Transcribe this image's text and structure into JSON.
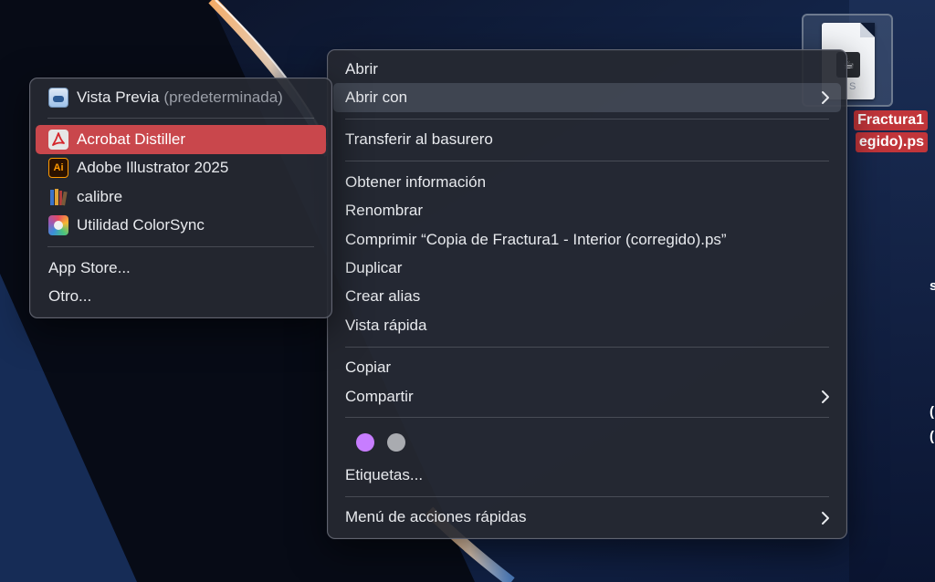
{
  "desktop": {
    "file": {
      "label_line1": "Fractura1",
      "label_line2": "egido).ps",
      "icon_glyph": "☕",
      "icon_ext": "S",
      "label_color": "#c1353a"
    },
    "edge_chars": [
      "s",
      "(",
      "("
    ]
  },
  "context_menu": {
    "open": "Abrir",
    "open_with": "Abrir con",
    "move_to_trash": "Transferir al basurero",
    "get_info": "Obtener información",
    "rename": "Renombrar",
    "compress": "Comprimir “Copia de Fractura1 - Interior (corregido).ps”",
    "duplicate": "Duplicar",
    "make_alias": "Crear alias",
    "quick_look": "Vista rápida",
    "copy": "Copiar",
    "share": "Compartir",
    "tags": [
      {
        "color": "#c77dff"
      },
      {
        "color": "#a9abb0"
      }
    ],
    "tags_label": "Etiquetas...",
    "quick_actions": "Menú de acciones rápidas"
  },
  "open_with_submenu": {
    "default_app": "Vista Previa",
    "default_note": "(predeterminada)",
    "apps": [
      {
        "name": "Acrobat Distiller",
        "icon": "acrobat-icon"
      },
      {
        "name": "Adobe Illustrator 2025",
        "icon": "illustrator-icon",
        "icon_text": "Ai"
      },
      {
        "name": "calibre",
        "icon": "calibre-icon"
      },
      {
        "name": "Utilidad ColorSync",
        "icon": "colorsync-icon"
      }
    ],
    "app_store": "App Store...",
    "other": "Otro..."
  },
  "colors": {
    "highlight_red": "#c9474c",
    "menu_bg": "#262932"
  }
}
